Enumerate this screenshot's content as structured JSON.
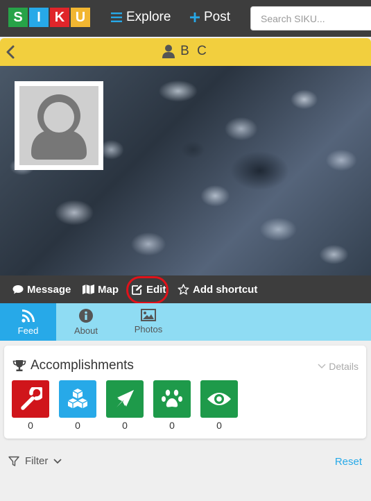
{
  "topbar": {
    "logo_letters": [
      {
        "letter": "S",
        "color": "#27a348"
      },
      {
        "letter": "I",
        "color": "#27a9e8"
      },
      {
        "letter": "K",
        "color": "#e0252a"
      },
      {
        "letter": "U",
        "color": "#f2b631"
      }
    ],
    "explore_label": "Explore",
    "post_label": "Post",
    "search_placeholder": "Search SIKU..."
  },
  "header": {
    "profile_name": "B C",
    "accent_color": "#f2cf3e"
  },
  "actions": {
    "message_label": "Message",
    "map_label": "Map",
    "edit_label": "Edit",
    "shortcut_label": "Add shortcut"
  },
  "tabs": [
    {
      "label": "Feed",
      "icon": "rss-icon",
      "active": true
    },
    {
      "label": "About",
      "icon": "info-icon",
      "active": false
    },
    {
      "label": "Photos",
      "icon": "image-icon",
      "active": false
    }
  ],
  "accomplishments": {
    "title": "Accomplishments",
    "details_label": "Details",
    "badges": [
      {
        "icon": "wrench-icon",
        "color": "#d0151b",
        "count": "0"
      },
      {
        "icon": "cubes-icon",
        "color": "#27a9e8",
        "count": "0"
      },
      {
        "icon": "location-arrow-icon",
        "color": "#1e9a4a",
        "count": "0"
      },
      {
        "icon": "paw-icon",
        "color": "#1e9a4a",
        "count": "0"
      },
      {
        "icon": "eye-icon",
        "color": "#1e9a4a",
        "count": "0"
      }
    ]
  },
  "filter": {
    "label": "Filter",
    "reset_label": "Reset"
  }
}
